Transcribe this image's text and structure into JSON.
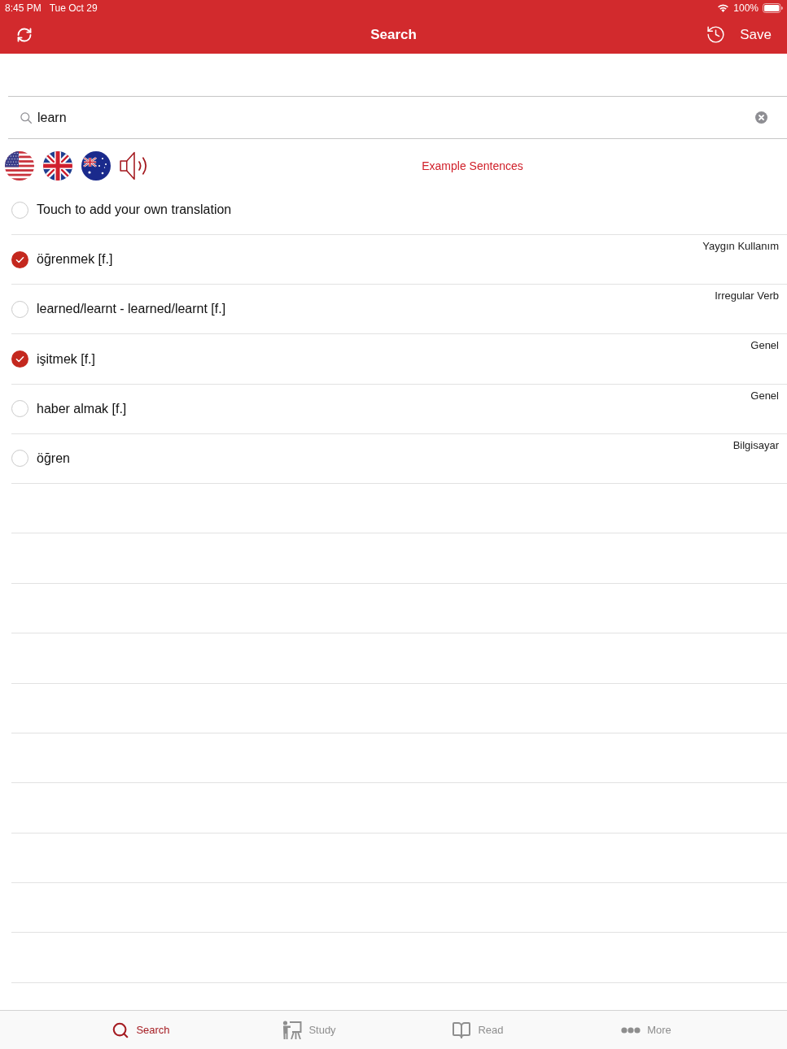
{
  "status_bar": {
    "time": "8:45 PM",
    "date": "Tue Oct 29",
    "battery": "100%"
  },
  "nav_bar": {
    "title": "Search",
    "save_button": "Save"
  },
  "search": {
    "value": "learn"
  },
  "example_sentences_link": "Example Sentences",
  "add_translation": {
    "label": "Touch to add your own translation",
    "checked": false
  },
  "translations": [
    {
      "text": "öğrenmek [f.]",
      "category": "Yaygın Kullanım",
      "checked": true
    },
    {
      "text": "learned/learnt - learned/learnt [f.]",
      "category": "Irregular Verb",
      "checked": false
    },
    {
      "text": "işitmek [f.]",
      "category": "Genel",
      "checked": true
    },
    {
      "text": "haber almak [f.]",
      "category": "Genel",
      "checked": false
    },
    {
      "text": "öğren",
      "category": "Bilgisayar",
      "checked": false
    }
  ],
  "tabs": [
    {
      "label": "Search",
      "selected": true
    },
    {
      "label": "Study",
      "selected": false
    },
    {
      "label": "Read",
      "selected": false
    },
    {
      "label": "More",
      "selected": false
    }
  ]
}
